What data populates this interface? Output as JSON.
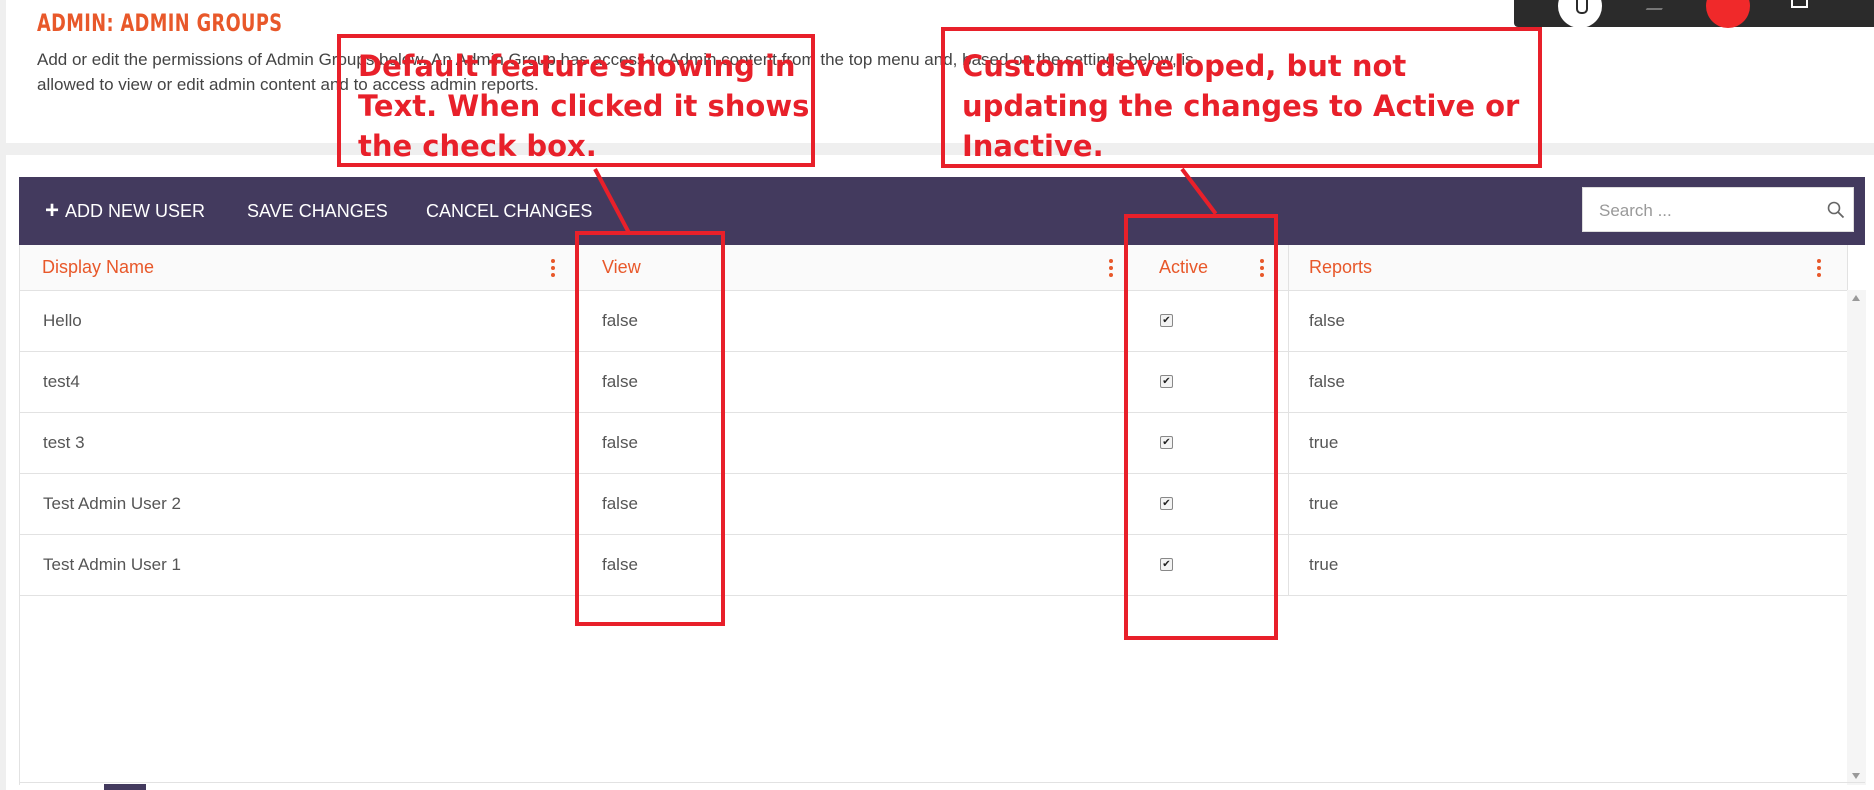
{
  "page": {
    "title": "ADMIN: ADMIN GROUPS",
    "description": "Add or edit the permissions of Admin Groups below. An Admin Group has access to Admin content from the top menu and, based on the settings below, is allowed to view or edit admin content and to access admin reports."
  },
  "toolbar": {
    "add_label": "ADD NEW USER",
    "add_icon": "plus-icon",
    "save_label": "SAVE CHANGES",
    "cancel_label": "CANCEL CHANGES",
    "search_placeholder": "Search ..."
  },
  "grid": {
    "columns": [
      "Display Name",
      "View",
      "Active",
      "Reports"
    ],
    "rows": [
      {
        "name": "Hello",
        "view": "false",
        "active": true,
        "reports": "false"
      },
      {
        "name": "test4",
        "view": "false",
        "active": true,
        "reports": "false"
      },
      {
        "name": "test 3",
        "view": "false",
        "active": true,
        "reports": "true"
      },
      {
        "name": "Test Admin User 2",
        "view": "false",
        "active": true,
        "reports": "true"
      },
      {
        "name": "Test Admin User 1",
        "view": "false",
        "active": true,
        "reports": "true"
      }
    ]
  },
  "annotations": {
    "view_note": "Default feature showing in Text. When clicked it shows the check box.",
    "active_note": "Custom developed, but not updating the changes to Active or Inactive."
  },
  "colors": {
    "accent": "#e8582a",
    "toolbar_bg": "#433a5e",
    "annotation": "#e8202a"
  }
}
